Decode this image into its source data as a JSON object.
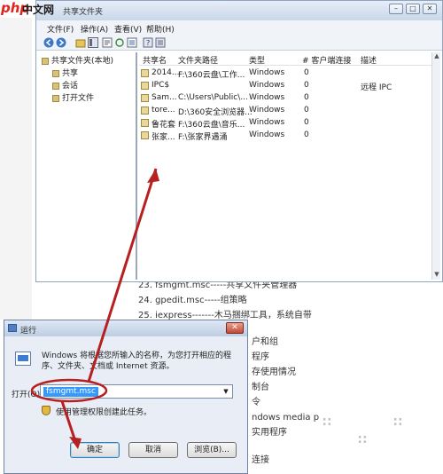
{
  "brand": {
    "logo_php": "php",
    "logo_zh": "中文网"
  },
  "explorer": {
    "title": "共享文件夹",
    "window_buttons": [
      "–",
      "□",
      "✕"
    ],
    "menu": [
      "文件(F)",
      "操作(A)",
      "查看(V)",
      "帮助(H)"
    ],
    "tree": {
      "root": "共享文件夹(本地)",
      "children": [
        "共享",
        "会话",
        "打开文件"
      ]
    },
    "columns": [
      "共享名",
      "文件夹路径",
      "类型",
      "# 客户端连接",
      "描述"
    ],
    "rows": [
      {
        "name": "2014...",
        "path": "F:\\360云盘\\工作...",
        "type": "Windows",
        "clients": "0",
        "desc": ""
      },
      {
        "name": "IPC$",
        "path": "",
        "type": "Windows",
        "clients": "0",
        "desc": "远程 IPC"
      },
      {
        "name": "Sam...",
        "path": "C:\\Users\\Public\\...",
        "type": "Windows",
        "clients": "0",
        "desc": ""
      },
      {
        "name": "tore...",
        "path": "D:\\360安全浏览器...",
        "type": "Windows",
        "clients": "0",
        "desc": ""
      },
      {
        "name": "鲁花套",
        "path": "F:\\360云盘\\音乐...",
        "type": "Windows",
        "clients": "0",
        "desc": ""
      },
      {
        "name": "张家...",
        "path": "F:\\张家界遇涌",
        "type": "Windows",
        "clients": "0",
        "desc": ""
      }
    ]
  },
  "article": {
    "lines": [
      "23. fsmgmt.msc-----共享文件夹管理器",
      "24. gpedit.msc-----组策略",
      "25. iexpress-------木马捆绑工具，系统自带",
      "户和组",
      "程序",
      "存使用情况",
      "制台",
      "令",
      "ndows media p",
      "实用程序",
      "连接"
    ]
  },
  "run_dialog": {
    "title": "运行",
    "close": "✕",
    "description": "Windows 将根据您所输入的名称，为您打开相应的程序、文件夹、文档或 Internet 资源。",
    "open_label": "打开(O):",
    "input_value": "fsmgmt.msc",
    "admin_note": "使用管理权限创建此任务。",
    "buttons": {
      "ok": "确定",
      "cancel": "取消",
      "browse": "浏览(B)..."
    }
  },
  "colors": {
    "annotation": "#b72020",
    "accent": "#3399ff"
  }
}
